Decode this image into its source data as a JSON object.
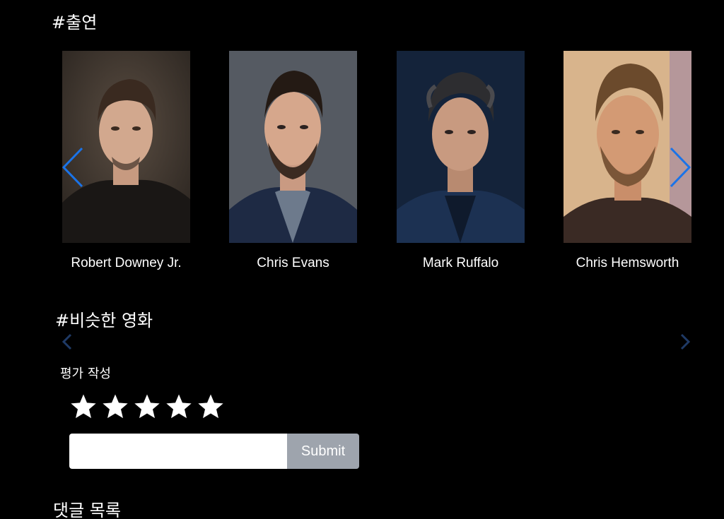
{
  "cast": {
    "title": "#출연",
    "members": [
      {
        "name": "Robert Downey Jr."
      },
      {
        "name": "Chris Evans"
      },
      {
        "name": "Mark Ruffalo"
      },
      {
        "name": "Chris Hemsworth"
      }
    ]
  },
  "similar": {
    "title": "#비슷한 영화"
  },
  "review": {
    "label": "평가 작성",
    "star_count": 5,
    "input_value": "",
    "input_placeholder": "",
    "submit_label": "Submit"
  },
  "comments": {
    "title": "댓글 목록"
  },
  "colors": {
    "background": "#000000",
    "arrow_active": "#1a73e8",
    "arrow_dim": "#1f3a66",
    "submit_bg": "#9ea4ad"
  }
}
